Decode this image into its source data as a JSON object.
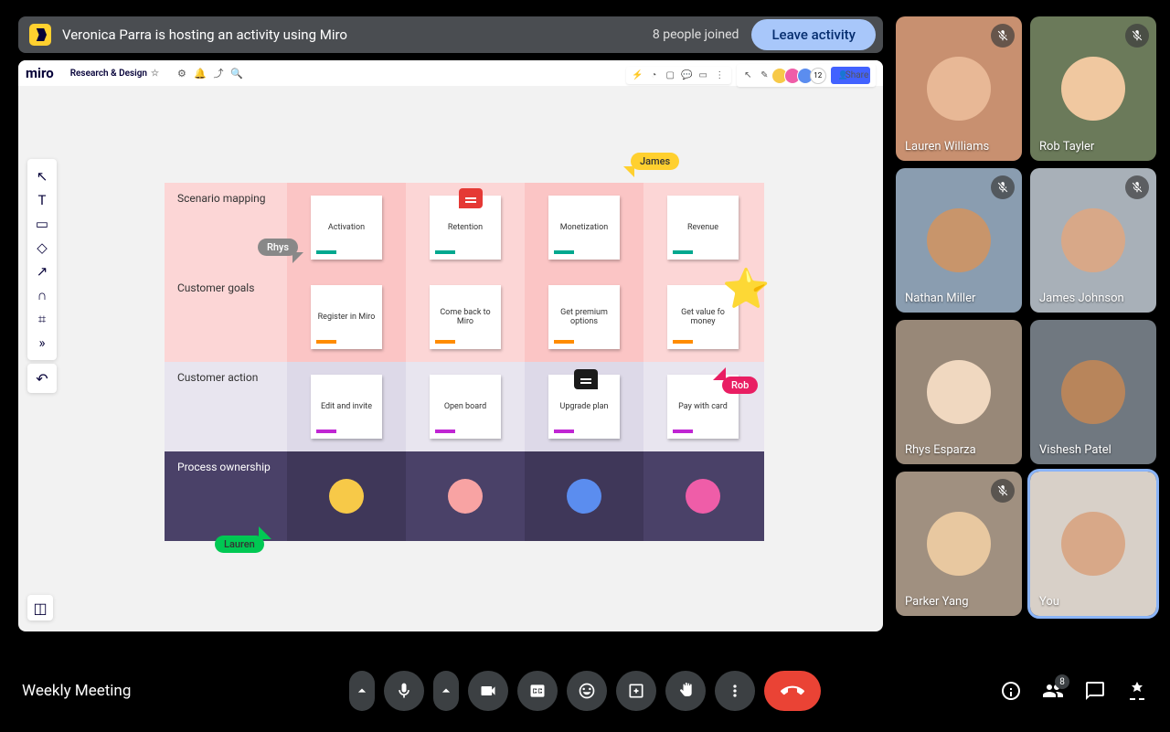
{
  "activity": {
    "host_text": "Veronica Parra is hosting an activity using Miro",
    "people_joined": "8 people joined",
    "leave": "Leave activity"
  },
  "miro": {
    "board_name": "Research & Design",
    "share": "Share",
    "participant_count": "12",
    "rows": [
      {
        "label": "Scenario mapping",
        "notes": [
          "Activation",
          "Retention",
          "Monetization",
          "Revenue"
        ],
        "color": "teal"
      },
      {
        "label": "Customer goals",
        "notes": [
          "Register in Miro",
          "Come back to Miro",
          "Get premium options",
          "Get value fo money"
        ],
        "color": "orange"
      },
      {
        "label": "Customer action",
        "notes": [
          "Edit and invite",
          "Open board",
          "Upgrade plan",
          "Pay with card"
        ],
        "color": "purple"
      },
      {
        "label": "Process ownership",
        "owners": [
          "#f7c948",
          "#f8a3a3",
          "#5b8def",
          "#ef5da8"
        ]
      }
    ],
    "cursors": {
      "james": "James",
      "rhys": "Rhys",
      "rob": "Rob",
      "lauren": "Lauren"
    }
  },
  "participants": [
    {
      "name": "Lauren Williams",
      "muted": true,
      "bg": "#c89070",
      "face": "#e8b896"
    },
    {
      "name": "Rob Tayler",
      "muted": true,
      "bg": "#6b7a5a",
      "face": "#f0c8a0"
    },
    {
      "name": "Nathan Miller",
      "muted": true,
      "bg": "#8a9db0",
      "face": "#c8956b"
    },
    {
      "name": "James Johnson",
      "muted": true,
      "bg": "#a8b0b8",
      "face": "#d8a888"
    },
    {
      "name": "Rhys Esparza",
      "muted": false,
      "bg": "#988878",
      "face": "#f0d8c0"
    },
    {
      "name": "Vishesh Patel",
      "muted": false,
      "bg": "#707880",
      "face": "#b8855b"
    },
    {
      "name": "Parker Yang",
      "muted": true,
      "bg": "#a09080",
      "face": "#e8c8a0"
    },
    {
      "name": "You",
      "muted": false,
      "bg": "#d8d0c8",
      "face": "#d8a888",
      "you": true
    }
  ],
  "meeting": {
    "name": "Weekly Meeting",
    "people_count": "8"
  }
}
